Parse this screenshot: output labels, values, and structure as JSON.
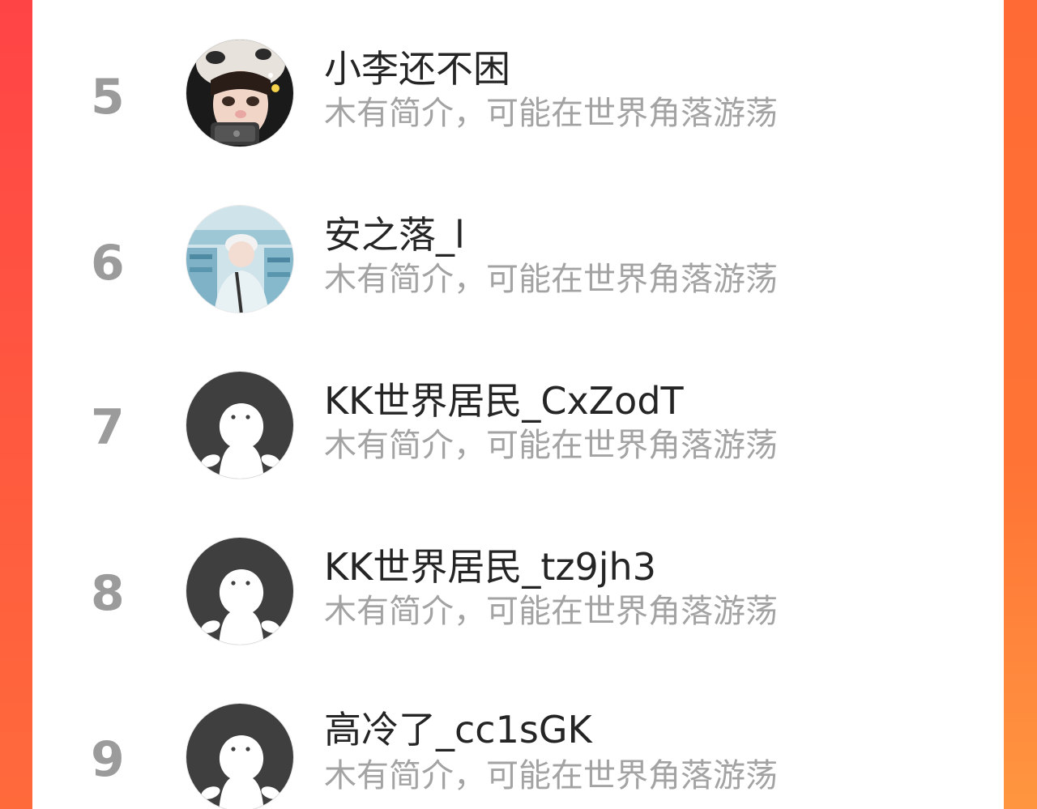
{
  "users": [
    {
      "rank": "5",
      "name": "小李还不困",
      "bio": "木有简介，可能在世界角落游荡",
      "avatar": "girl-photo-avatar"
    },
    {
      "rank": "6",
      "name": "安之落_l",
      "bio": "木有简介，可能在世界角落游荡",
      "avatar": "boy-photo-avatar"
    },
    {
      "rank": "7",
      "name": "KK世界居民_CxZodT",
      "bio": "木有简介，可能在世界角落游荡",
      "avatar": "default-avatar"
    },
    {
      "rank": "8",
      "name": "KK世界居民_tz9jh3",
      "bio": "木有简介，可能在世界角落游荡",
      "avatar": "default-avatar"
    },
    {
      "rank": "9",
      "name": "高冷了_cc1sGK",
      "bio": "木有简介，可能在世界角落游荡",
      "avatar": "default-avatar"
    }
  ],
  "colors": {
    "background_gradient_start": "#ff4a45",
    "background_gradient_end": "#ff7a35",
    "panel": "#ffffff",
    "rank_text": "#9b9b9b",
    "name_text": "#252525",
    "bio_text": "#a3a3a3",
    "default_avatar_bg": "#3f3f3f"
  }
}
